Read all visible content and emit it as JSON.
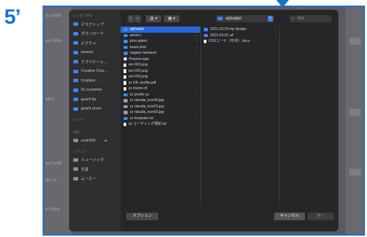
{
  "annotation": {
    "step_label": "5’"
  },
  "background_page": {
    "labels": [
      "ay Settin",
      "ay Addre",
      "ation",
      "ay Certifi",
      "itle 20",
      "d Policy"
    ]
  },
  "sidebar": {
    "sections": [
      {
        "title": "よく使う項目",
        "items": [
          {
            "label": "デスクトップ",
            "icon": "desktop-icon"
          },
          {
            "label": "ダウンロード",
            "icon": "download-icon"
          },
          {
            "label": "ピクチャ",
            "icon": "pictures-icon"
          },
          {
            "label": "tacawa",
            "icon": "home-icon"
          },
          {
            "label": "アプリケーシ…",
            "icon": "applications-icon"
          },
          {
            "label": "Creative Clou…",
            "icon": "folder-icon"
          },
          {
            "label": "Dropbox",
            "icon": "dropbox-icon"
          },
          {
            "label": "01.customer",
            "icon": "folder-icon"
          },
          {
            "label": "gear8 ftp",
            "icon": "folder-icon"
          },
          {
            "label": "gear8 photo",
            "icon": "folder-icon"
          }
        ]
      },
      {
        "title": "iCloud",
        "items": []
      },
      {
        "title": "場所",
        "items": [
          {
            "label": "unaHDD",
            "icon": "drive-icon"
          }
        ]
      },
      {
        "title": "メディア",
        "items": [
          {
            "label": "ミュージック",
            "icon": "music-icon"
          },
          {
            "label": "写真",
            "icon": "photos-icon"
          },
          {
            "label": "ムービー",
            "icon": "movies-icon"
          }
        ]
      }
    ]
  },
  "toolbar": {
    "back_glyph": "‹",
    "forward_glyph": "›",
    "view_columns_glyph": "▥ ▾",
    "view_grid_glyph": "▦ ▾",
    "location": "alphabet",
    "location_chevron": "⌃",
    "search_placeholder": "検索",
    "search_glyph": "⌕"
  },
  "columns": {
    "col1": [
      {
        "name": "alphabet",
        "kind": "folder",
        "selected": true,
        "has_children": true
      },
      {
        "name": "amelcc",
        "kind": "folder",
        "has_children": true
      },
      {
        "name": "jetro ajiken",
        "kind": "folder",
        "has_children": true
      },
      {
        "name": "kaset phol",
        "kind": "folder",
        "has_children": true
      },
      {
        "name": "nagase landauer",
        "kind": "folder",
        "has_children": true
      },
      {
        "name": "Prepros.app",
        "kind": "app"
      },
      {
        "name": "um-001.png",
        "kind": "file"
      },
      {
        "name": "um-002.png",
        "kind": "file"
      },
      {
        "name": "um-003.png",
        "kind": "file"
      },
      {
        "name": "zz G8- profile.pdf",
        "kind": "file"
      },
      {
        "name": "zz memo.rtf",
        "kind": "file"
      },
      {
        "name": "zz profile yu",
        "kind": "folder",
        "has_children": true
      },
      {
        "name": "zz rakuda_icon00.jpg",
        "kind": "img"
      },
      {
        "name": "zz rakuda_icon01.jpg",
        "kind": "img"
      },
      {
        "name": "zz rakuda_icon02.jpg",
        "kind": "img"
      },
      {
        "name": "zz template ed",
        "kind": "folder",
        "has_children": true
      },
      {
        "name": "zz コーディング規約.txt",
        "kind": "file"
      }
    ],
    "col2": [
      {
        "name": "2021-03-29 top design",
        "kind": "folder",
        "has_children": true
      },
      {
        "name": "2021-04-01 wf",
        "kind": "folder",
        "has_children": true
      },
      {
        "name": "CSSコード（平井）.docx",
        "kind": "file"
      }
    ]
  },
  "footer": {
    "options_label": "オプション",
    "cancel_label": "キャンセル",
    "open_label": "開く"
  },
  "colors": {
    "accent": "#2a66d6",
    "annotation": "#1a73c9"
  }
}
